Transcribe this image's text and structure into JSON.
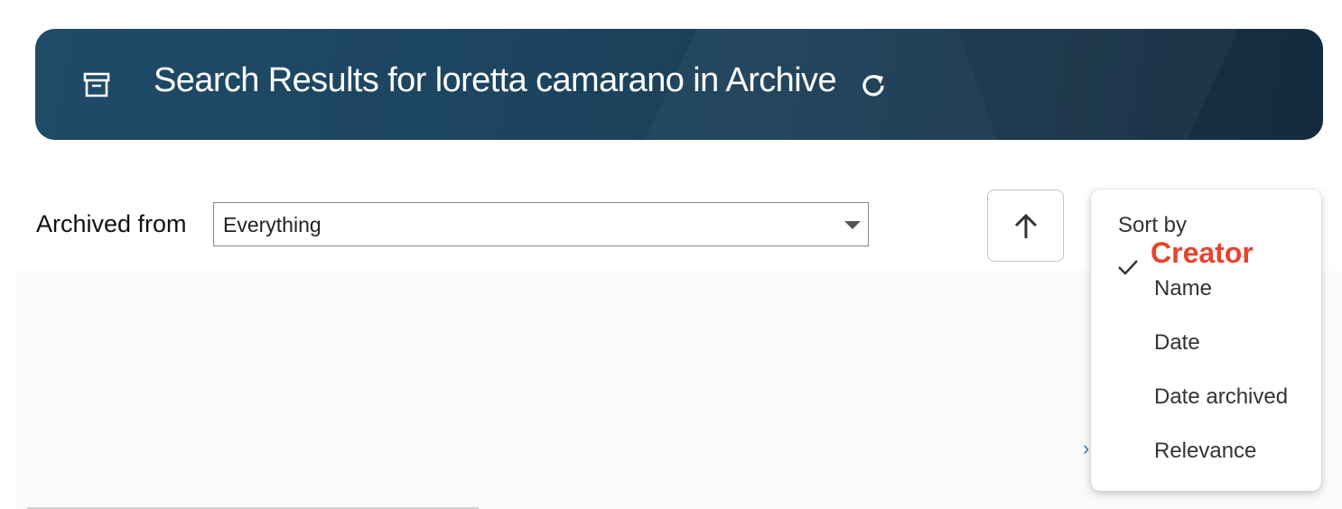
{
  "banner": {
    "title": "Search Results for loretta camarano in Archive",
    "archive_icon": "archive-box-icon",
    "refresh_icon": "refresh-icon"
  },
  "filter": {
    "label": "Archived from",
    "selected_value": "Everything"
  },
  "sort": {
    "direction_icon": "arrow-up-icon",
    "menu_header": "Sort by",
    "tooltip": "Creator",
    "options": [
      {
        "label": "Name",
        "selected": true
      },
      {
        "label": "Date",
        "selected": false
      },
      {
        "label": "Date archived",
        "selected": false
      },
      {
        "label": "Relevance",
        "selected": false
      }
    ]
  },
  "colors": {
    "banner_bg": "#1d4560",
    "tooltip_text": "#e8432d",
    "text_primary": "#111111"
  }
}
